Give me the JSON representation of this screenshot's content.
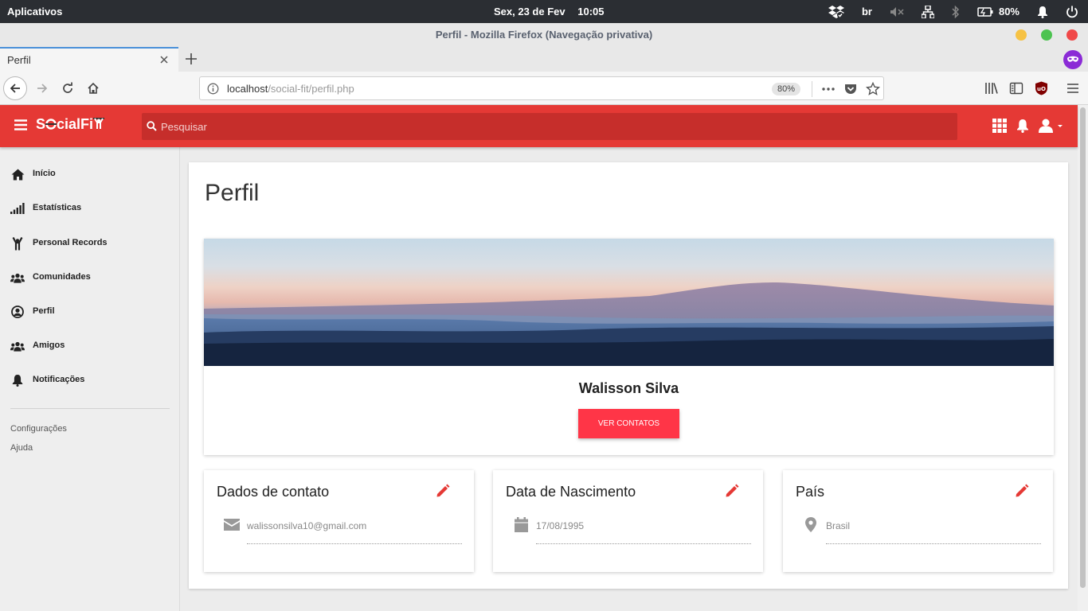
{
  "os": {
    "apps_label": "Aplicativos",
    "date": "Sex, 23 de Fev",
    "time": "10:05",
    "keyboard_layout": "br",
    "battery": "80%"
  },
  "browser": {
    "window_title": "Perfil - Mozilla Firefox (Navegação privativa)",
    "tab_title": "Perfil",
    "url_host": "localhost",
    "url_path": "/social-fit/perfil.php",
    "zoom": "80%"
  },
  "app": {
    "brand_prefix": "S",
    "brand_middle": "cialFi",
    "search_placeholder": "Pesquisar",
    "accent_color": "#e53935"
  },
  "sidebar": {
    "items": [
      {
        "label": "Início",
        "icon": "home-icon"
      },
      {
        "label": "Estatísticas",
        "icon": "signal-bars-icon"
      },
      {
        "label": "Personal Records",
        "icon": "weightlifter-icon"
      },
      {
        "label": "Comunidades",
        "icon": "users-group-icon"
      },
      {
        "label": "Perfil",
        "icon": "user-circle-icon"
      },
      {
        "label": "Amigos",
        "icon": "users-group-icon"
      },
      {
        "label": "Notificações",
        "icon": "bell-icon"
      }
    ],
    "settings_label": "Configurações",
    "help_label": "Ajuda"
  },
  "profile": {
    "page_title": "Perfil",
    "name": "Walisson Silva",
    "contacts_button": "VER CONTATOS",
    "cards": [
      {
        "title": "Dados de contato",
        "value": "walissonsilva10@gmail.com",
        "icon": "envelope-icon"
      },
      {
        "title": "Data de Nascimento",
        "value": "17/08/1995",
        "icon": "calendar-icon"
      },
      {
        "title": "País",
        "value": "Brasil",
        "icon": "map-pin-icon"
      }
    ]
  }
}
